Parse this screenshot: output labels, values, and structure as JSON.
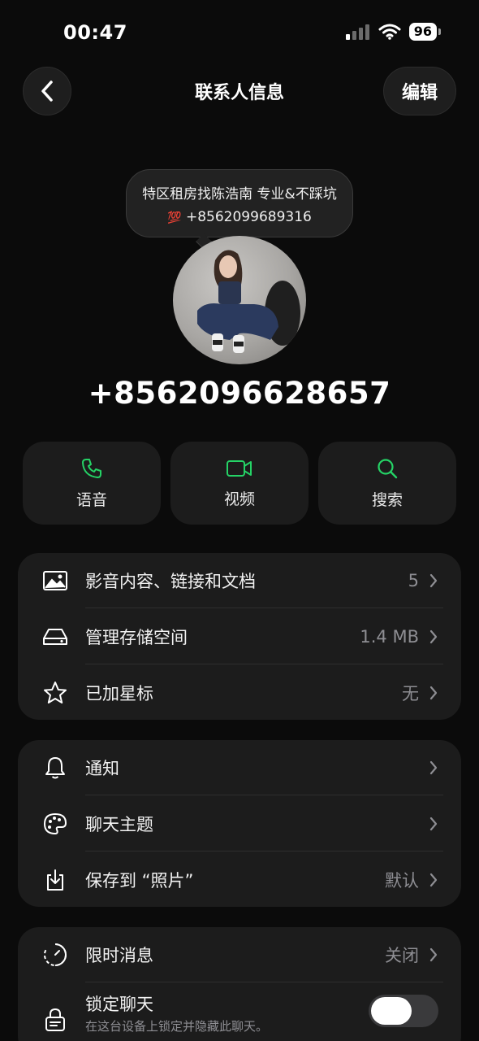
{
  "status_bar": {
    "time": "00:47",
    "battery": "96"
  },
  "header": {
    "title": "联系人信息",
    "edit_label": "编辑"
  },
  "profile": {
    "bio_line1": "特区租房找陈浩南 专业&不踩坑",
    "bio_line2_emoji": "💯",
    "bio_line2_text": "+8562099689316",
    "phone": "+8562096628657"
  },
  "actions": [
    {
      "label": "语音",
      "icon": "phone-icon"
    },
    {
      "label": "视频",
      "icon": "video-icon"
    },
    {
      "label": "搜索",
      "icon": "search-icon"
    }
  ],
  "group1": [
    {
      "label": "影音内容、链接和文档",
      "value": "5",
      "icon": "image-icon"
    },
    {
      "label": "管理存储空间",
      "value": "1.4 MB",
      "icon": "storage-icon"
    },
    {
      "label": "已加星标",
      "value": "无",
      "icon": "star-icon"
    }
  ],
  "group2": [
    {
      "label": "通知",
      "value": "",
      "icon": "bell-icon"
    },
    {
      "label": "聊天主题",
      "value": "",
      "icon": "palette-icon"
    },
    {
      "label": "保存到 “照片”",
      "value": "默认",
      "icon": "save-icon"
    }
  ],
  "group3": [
    {
      "label": "限时消息",
      "value": "关闭",
      "icon": "timer-icon"
    },
    {
      "label": "锁定聊天",
      "sub": "在这台设备上锁定并隐藏此聊天。",
      "icon": "lock-chat-icon",
      "toggle": "off"
    }
  ],
  "colors": {
    "accent": "#25d366",
    "background": "#0b0b0b",
    "card": "#1c1c1c"
  }
}
